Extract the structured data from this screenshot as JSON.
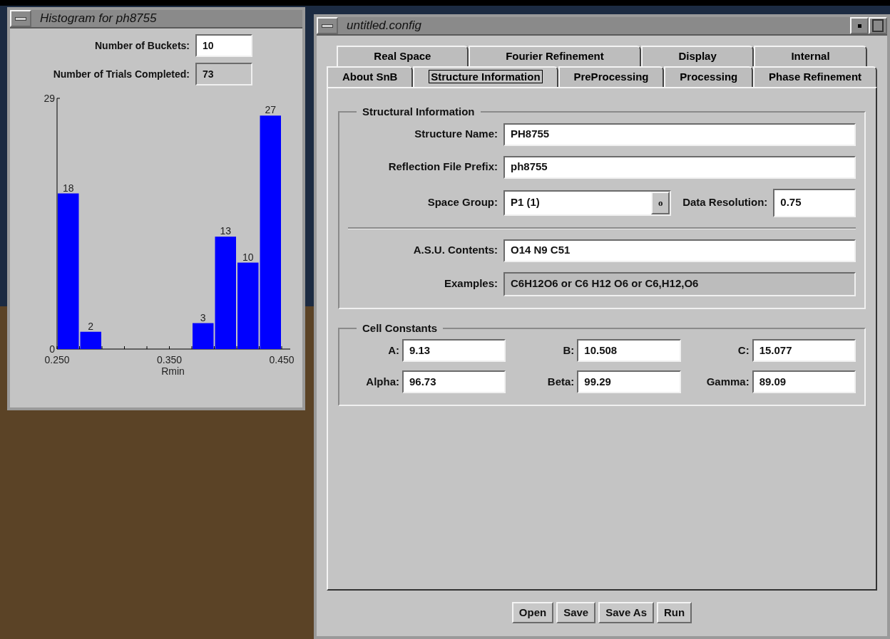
{
  "histogram_window": {
    "title": "Histogram for ph8755",
    "fields": [
      {
        "label": "Number of Buckets:",
        "value": "10",
        "disabled": false
      },
      {
        "label": "Number of Trials Completed:",
        "value": "73",
        "disabled": true
      }
    ],
    "chart_data": {
      "type": "bar",
      "xlabel": "Rmin",
      "x": [
        0.26,
        0.28,
        0.3,
        0.32,
        0.34,
        0.36,
        0.38,
        0.4,
        0.42,
        0.44
      ],
      "values": [
        18,
        2,
        0,
        0,
        0,
        0,
        3,
        13,
        10,
        27
      ],
      "xlim": [
        0.25,
        0.45
      ],
      "ylim": [
        0,
        29
      ],
      "xticks": [
        {
          "value": 0.25,
          "label": "0.250"
        },
        {
          "value": 0.35,
          "label": "0.350"
        },
        {
          "value": 0.45,
          "label": "0.450"
        }
      ],
      "yticks": [
        0,
        29
      ],
      "value_labels": [
        "18",
        "2",
        null,
        null,
        null,
        null,
        "3",
        "13",
        "10",
        "27"
      ]
    }
  },
  "config_window": {
    "title": "untitled.config",
    "tab_rows": [
      [
        {
          "label": "Real Space",
          "selected": false
        },
        {
          "label": "Fourier Refinement",
          "selected": false
        },
        {
          "label": "Display",
          "selected": false
        },
        {
          "label": "Internal",
          "selected": false
        }
      ],
      [
        {
          "label": "About SnB",
          "selected": false
        },
        {
          "label": "Structure Information",
          "selected": true
        },
        {
          "label": "PreProcessing",
          "selected": false
        },
        {
          "label": "Processing",
          "selected": false
        },
        {
          "label": "Phase Refinement",
          "selected": false
        }
      ]
    ],
    "structural_information": {
      "title": "Structural Information",
      "structure_name": {
        "label": "Structure Name:",
        "value": "PH8755"
      },
      "reflection_file_prefix": {
        "label": "Reflection File Prefix:",
        "value": "ph8755"
      },
      "space_group": {
        "label": "Space Group:",
        "value": "P1 (1)",
        "button": "o"
      },
      "data_resolution": {
        "label": "Data Resolution:",
        "value": "0.75"
      },
      "asu_contents": {
        "label": "A.S.U. Contents:",
        "value": "O14 N9 C51"
      },
      "examples": {
        "label": "Examples:",
        "value": "C6H12O6 or C6 H12 O6 or C6,H12,O6"
      }
    },
    "cell_constants": {
      "title": "Cell Constants",
      "fields": [
        {
          "label": "A:",
          "value": "9.13"
        },
        {
          "label": "B:",
          "value": "10.508"
        },
        {
          "label": "C:",
          "value": "15.077"
        },
        {
          "label": "Alpha:",
          "value": "96.73"
        },
        {
          "label": "Beta:",
          "value": "99.29"
        },
        {
          "label": "Gamma:",
          "value": "89.09"
        }
      ]
    },
    "buttons": [
      "Open",
      "Save",
      "Save As",
      "Run"
    ]
  }
}
